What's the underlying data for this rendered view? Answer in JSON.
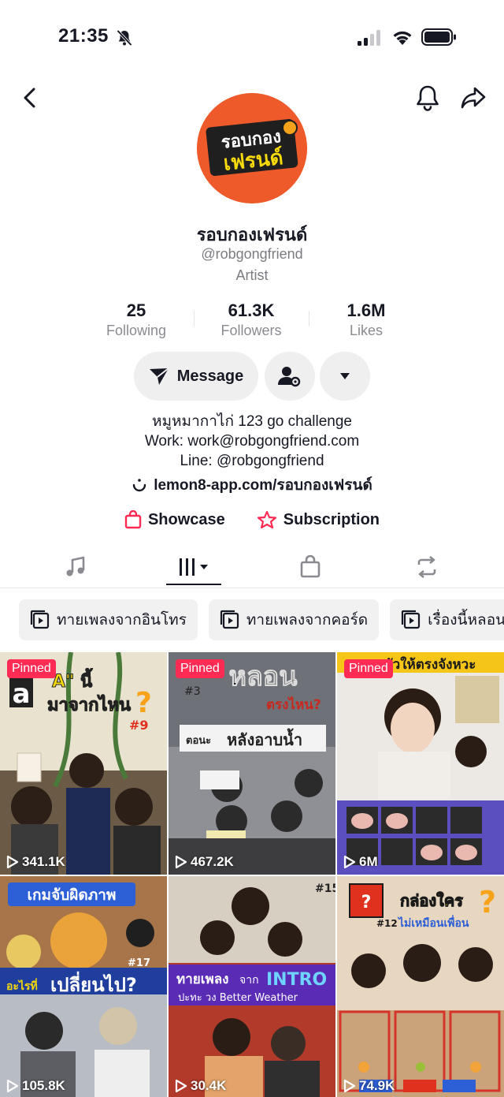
{
  "status_bar": {
    "time": "21:35"
  },
  "profile": {
    "name": "รอบกองเฟรนด์",
    "handle": "@robgongfriend",
    "category": "Artist",
    "avatar_text": [
      "รอบกอง",
      "เฟรนด์"
    ],
    "avatar_color": "#ee5a2a"
  },
  "stats": [
    {
      "value": "25",
      "label": "Following"
    },
    {
      "value": "61.3K",
      "label": "Followers"
    },
    {
      "value": "1.6M",
      "label": "Likes"
    }
  ],
  "actions": {
    "message_label": "Message"
  },
  "bio": {
    "lines": [
      "หมูหมากาไก่ 123 go challenge",
      "Work: work@robgongfriend.com",
      "Line: @robgongfriend"
    ],
    "link": "lemon8-app.com/รอบกองเฟรนด์"
  },
  "features": {
    "showcase": "Showcase",
    "subscription": "Subscription"
  },
  "playlists": [
    "ทายเพลงจากอินโทร",
    "ทายเพลงจากคอร์ด",
    "เรื่องนี้หลอนต"
  ],
  "pinned_label": "Pinned",
  "videos": [
    {
      "views": "341.1K",
      "pinned": true,
      "caption": "A นี้ มาจากไหน",
      "episode": "#9"
    },
    {
      "views": "467.2K",
      "pinned": true,
      "caption": "หลอน",
      "episode": "#3"
    },
    {
      "views": "6M",
      "pinned": true,
      "caption": "ตัวให้ตรงจังหวะ",
      "episode": ""
    },
    {
      "views": "105.8K",
      "pinned": false,
      "caption": "เกมจับผิดภาพ",
      "episode": "#17"
    },
    {
      "views": "30.4K",
      "pinned": false,
      "caption": "ทายเพลง จาก INTRO",
      "episode": "#15"
    },
    {
      "views": "74.9K",
      "pinned": false,
      "caption": "กล่องใคร",
      "episode": "#12"
    }
  ],
  "colors": {
    "accent": "#fe2c55",
    "text": "#161823",
    "secondary": "#8a8b91"
  }
}
